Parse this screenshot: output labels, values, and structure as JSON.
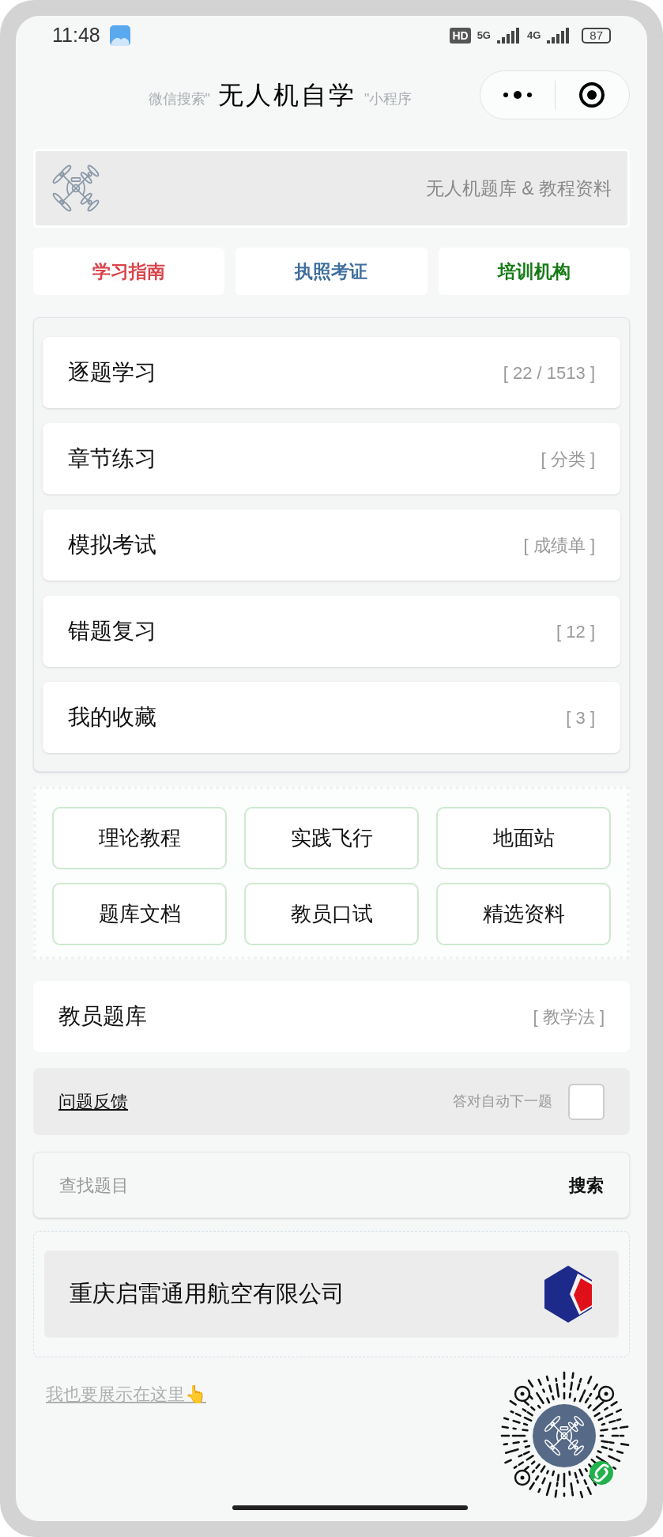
{
  "status_bar": {
    "time": "11:48",
    "hd": "HD",
    "net_1": "5G",
    "net_2": "4G",
    "battery": "87"
  },
  "header": {
    "prefix": "微信搜索\"",
    "title": "无人机自学",
    "suffix": "\"小程序"
  },
  "banner": {
    "text": "无人机题库 & 教程资料"
  },
  "tabs": [
    {
      "label": "学习指南",
      "color": "#d9434a"
    },
    {
      "label": "执照考证",
      "color": "#3f6f9e"
    },
    {
      "label": "培训机构",
      "color": "#157a15"
    }
  ],
  "menu": [
    {
      "label": "逐题学习",
      "tag": "[ 22 / 1513 ]"
    },
    {
      "label": "章节练习",
      "tag": "[ 分类 ]"
    },
    {
      "label": "模拟考试",
      "tag": "[ 成绩单 ]"
    },
    {
      "label": "错题复习",
      "tag": "[ 12 ]"
    },
    {
      "label": "我的收藏",
      "tag": "[ 3 ]"
    }
  ],
  "resources": [
    "理论教程",
    "实践飞行",
    "地面站",
    "题库文档",
    "教员口试",
    "精选资料"
  ],
  "instructor": {
    "label": "教员题库",
    "tag": "[ 教学法 ]"
  },
  "feedback": {
    "link": "问题反馈",
    "auto_next_label": "答对自动下一题",
    "auto_next_checked": false
  },
  "search": {
    "placeholder": "查找题目",
    "button": "搜索"
  },
  "sponsor": {
    "name": "重庆启雷通用航空有限公司"
  },
  "promo_link": "我也要展示在这里👆"
}
